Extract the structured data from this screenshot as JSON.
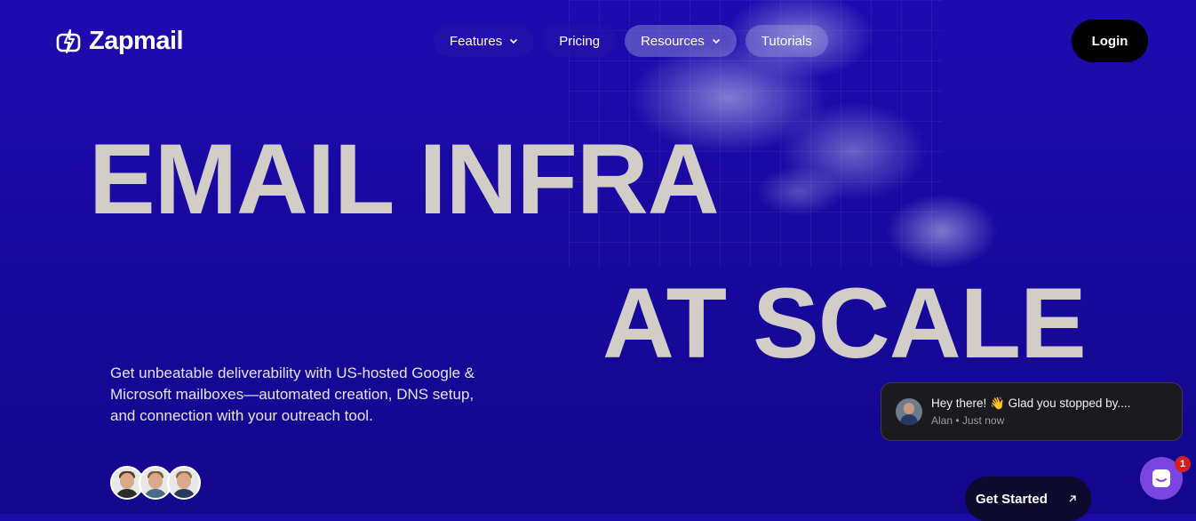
{
  "brand": {
    "name": "Zapmail"
  },
  "nav": {
    "items": [
      {
        "label": "Features",
        "has_dropdown": true
      },
      {
        "label": "Pricing",
        "has_dropdown": false
      },
      {
        "label": "Resources",
        "has_dropdown": true
      },
      {
        "label": "Tutorials",
        "has_dropdown": false
      }
    ],
    "login_label": "Login"
  },
  "hero": {
    "line1": "EMAIL INFRA",
    "line2": "AT SCALE",
    "subtitle": "Get unbeatable deliverability with US-hosted Google & Microsoft mailboxes—automated creation, DNS setup, and connection with your outreach tool."
  },
  "cta": {
    "label": "Get Started",
    "icon": "arrow-up-right-icon"
  },
  "chat_popup": {
    "message": "Hey there! 👋 Glad you stopped by....",
    "meta": "Alan • Just now"
  },
  "chat_launcher": {
    "badge_count": "1"
  },
  "colors": {
    "background": "#1a0aa8",
    "hero_text": "#d2cdc6",
    "login_bg": "#000000",
    "launcher": "#7a45e0",
    "badge": "#d42020"
  }
}
